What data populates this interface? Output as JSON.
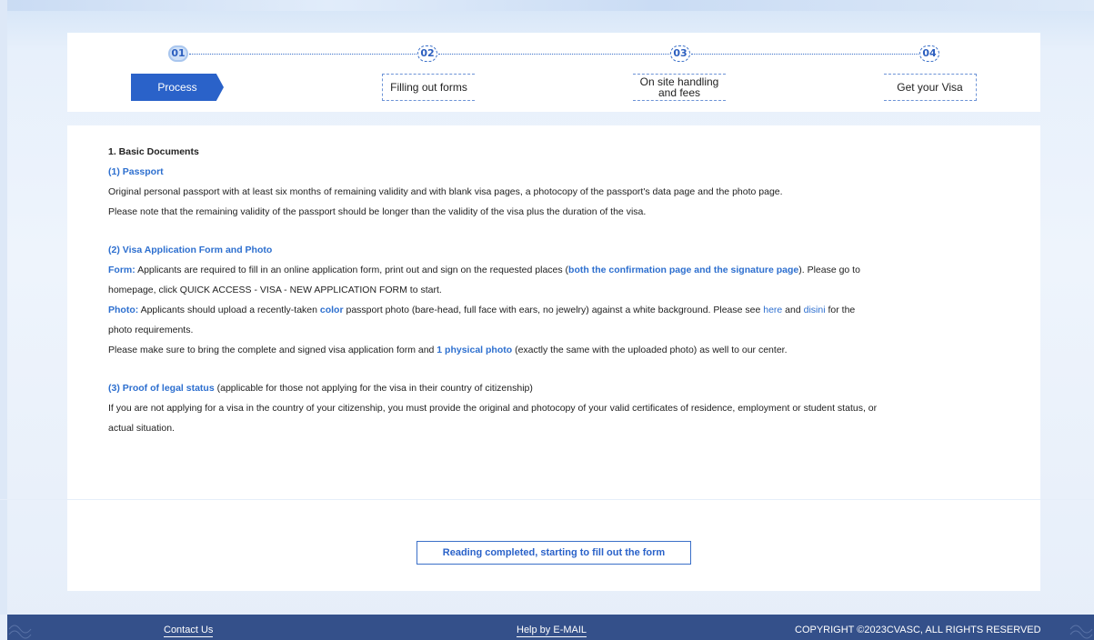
{
  "steps": [
    {
      "num": "01",
      "label": "Process",
      "active": true
    },
    {
      "num": "02",
      "label": "Filling out forms",
      "active": false
    },
    {
      "num": "03",
      "label_line1": "On site handling",
      "label_line2": "and fees",
      "active": false
    },
    {
      "num": "04",
      "label": "Get your Visa",
      "active": false
    }
  ],
  "content": {
    "section_title": "1. Basic Documents",
    "passport": {
      "heading": "(1) Passport",
      "p1": "Original personal passport with at least six months of remaining validity and with blank visa pages, a photocopy of the passport's data page and the photo page.",
      "p2": "Please note that the remaining validity of the passport should be longer than the validity of the visa plus the duration of the visa."
    },
    "visa_form": {
      "heading": "(2) Visa Application Form and Photo",
      "form_label": "Form:",
      "form_text_a": " Applicants are required to fill in an online application form, print out and sign on the requested places (",
      "form_highlight": "both the confirmation page and the signature page",
      "form_text_b": "). Please go to",
      "form_text_c": "homepage, click QUICK ACCESS - VISA - NEW APPLICATION FORM to start.",
      "photo_label": "Photo:",
      "photo_text_a": " Applicants should upload a recently-taken ",
      "photo_highlight": "color",
      "photo_text_b": " passport photo (bare-head, full face with ears, no jewelry) against a white background. Please see ",
      "here_link": "here",
      "and_text": " and ",
      "disini_link": "disini",
      "photo_text_c": " for the",
      "photo_text_d": "photo requirements.",
      "bring_text_a": "Please make sure to bring the complete and signed visa application form and ",
      "bring_highlight": "1 physical photo",
      "bring_text_b": " (exactly the same with the uploaded photo) as well to our center."
    },
    "legal_status": {
      "heading": "(3) Proof of legal status",
      "heading_note": " (applicable for those not applying for the visa in their country of citizenship)",
      "p1": "If you are not applying for a visa in the country of your citizenship, you must provide the original and photocopy of your valid certificates of residence, employment or student status, or",
      "p2": "actual situation."
    }
  },
  "cta": {
    "label": "Reading completed, starting to fill out the form"
  },
  "footer": {
    "contact": "Contact Us",
    "help": "Help by E-MAIL",
    "copyright": "COPYRIGHT ©2023CVASC, ALL RIGHTS RESERVED"
  },
  "colors": {
    "accent": "#2a62c9",
    "footer": "#34508a",
    "link": "#2d6fcf"
  }
}
